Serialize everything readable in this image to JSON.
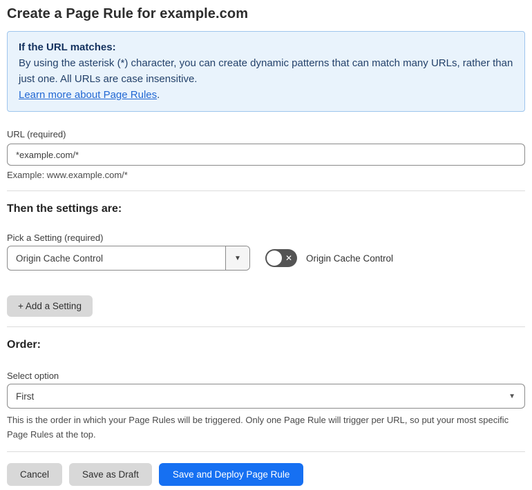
{
  "page": {
    "title": "Create a Page Rule for example.com"
  },
  "info_box": {
    "heading": "If the URL matches:",
    "body": "By using the asterisk (*) character, you can create dynamic patterns that can match many URLs, rather than just one. All URLs are case insensitive.",
    "link": "Learn more about Page Rules",
    "link_suffix": "."
  },
  "url_field": {
    "label": "URL (required)",
    "value": "*example.com/*",
    "helper": "Example: www.example.com/*"
  },
  "settings_section": {
    "heading": "Then the settings are:",
    "picker_label": "Pick a Setting (required)",
    "picker_value": "Origin Cache Control",
    "toggle_label": "Origin Cache Control",
    "toggle_state": "off",
    "add_button": "+ Add a Setting"
  },
  "order_section": {
    "heading": "Order:",
    "select_label": "Select option",
    "select_value": "First",
    "helper": "This is the order in which your Page Rules will be triggered. Only one Page Rule will trigger per URL, so put your most specific Page Rules at the top."
  },
  "footer": {
    "cancel": "Cancel",
    "save_draft": "Save as Draft",
    "save_deploy": "Save and Deploy Page Rule"
  },
  "icons": {
    "chevron_down": "▼",
    "toggle_x": "✕"
  },
  "colors": {
    "accent_blue": "#1670f2",
    "info_bg": "#e9f3fc",
    "info_border": "#9ec5ed",
    "info_text": "#24426b",
    "link_blue": "#2268d3",
    "toggle_off_bg": "#545454",
    "button_gray": "#d8d8d8"
  }
}
